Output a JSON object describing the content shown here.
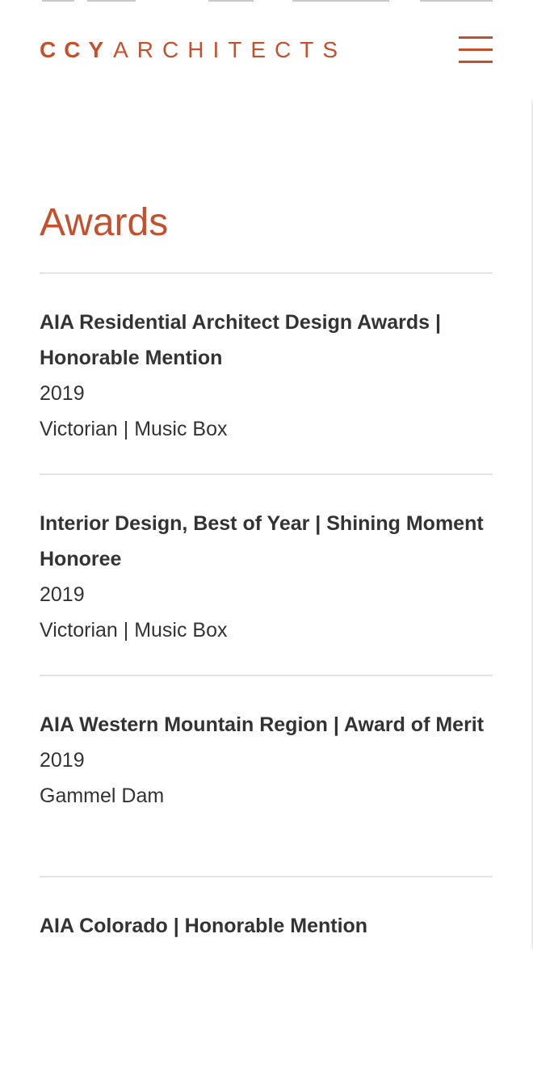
{
  "header": {
    "logo_bold": "CCY",
    "logo_light": "ARCHITECTS",
    "menu_icon": "hamburger-menu-icon"
  },
  "page": {
    "title": "Awards"
  },
  "awards": [
    {
      "name": "AIA Residential Architect Design Awards | Honorable Mention",
      "year": "2019",
      "project": "Victorian | Music Box"
    },
    {
      "name": "Interior Design, Best of Year | Shining Moment Honoree",
      "year": "2019",
      "project": "Victorian | Music Box"
    },
    {
      "name": "AIA Western Mountain Region | Award of Merit",
      "year": "2019",
      "project": "Gammel Dam"
    },
    {
      "name": "AIA Colorado | Honorable Mention",
      "year": "",
      "project": ""
    }
  ],
  "colors": {
    "accent": "#c4512e",
    "text": "#333333",
    "divider": "#e3e3e3"
  }
}
